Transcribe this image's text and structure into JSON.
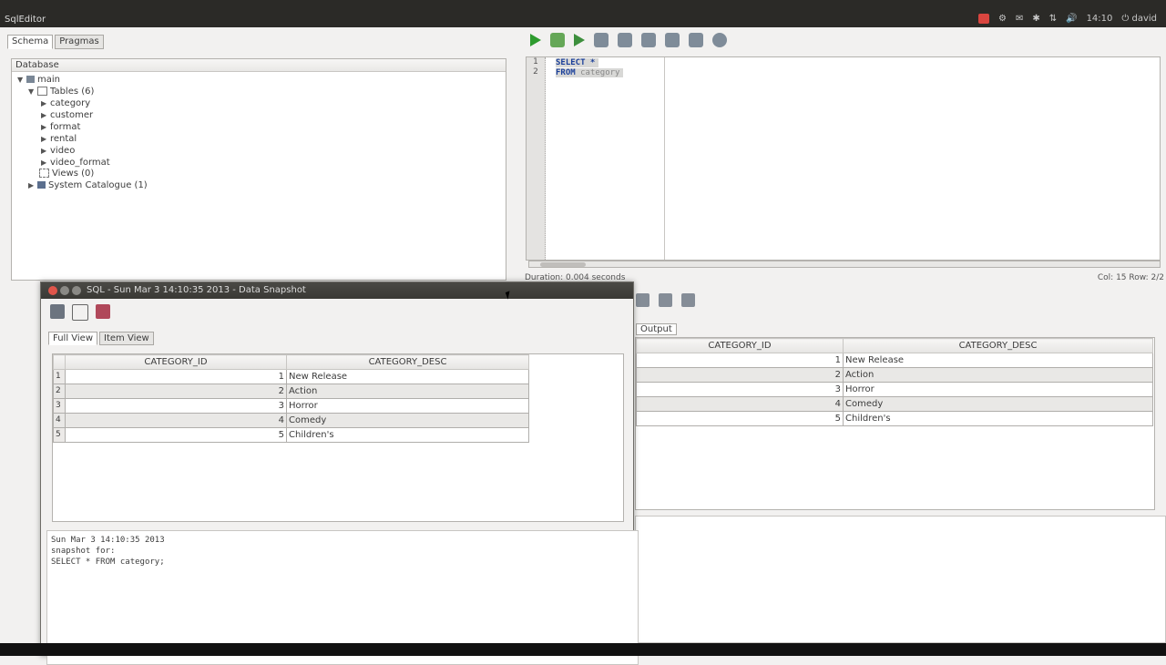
{
  "app": {
    "title": "SqlEditor"
  },
  "tray": {
    "items": [
      "⚙",
      "✉",
      "✱",
      "⇅",
      "🔊",
      "14:10",
      "⏻ david"
    ]
  },
  "schema": {
    "tabs": [
      "Schema",
      "Pragmas"
    ],
    "header": "Database",
    "tree": {
      "main": "main",
      "tables_label": "Tables (6)",
      "tables": [
        "category",
        "customer",
        "format",
        "rental",
        "video",
        "video_format"
      ],
      "views_label": "Views (0)",
      "system_label": "System Catalogue (1)"
    }
  },
  "editor": {
    "line_numbers": [
      "1",
      "2"
    ],
    "line1": "SELECT *",
    "line2_kw": "FROM",
    "line2_table": "category"
  },
  "status": {
    "duration": "Duration: 0.004 seconds",
    "cursor": "Col: 15 Row: 2/2"
  },
  "results": {
    "tab": "Output",
    "columns": [
      "CATEGORY_ID",
      "CATEGORY_DESC"
    ],
    "rows": [
      {
        "id": "1",
        "desc": "New Release"
      },
      {
        "id": "2",
        "desc": "Action"
      },
      {
        "id": "3",
        "desc": "Horror"
      },
      {
        "id": "4",
        "desc": "Comedy"
      },
      {
        "id": "5",
        "desc": "Children's"
      }
    ]
  },
  "snapshot": {
    "title": "SQL - Sun Mar 3 14:10:35 2013 - Data Snapshot",
    "tabs": [
      "Full View",
      "Item View"
    ],
    "columns": [
      "CATEGORY_ID",
      "CATEGORY_DESC"
    ],
    "rows": [
      {
        "rn": "1",
        "id": "1",
        "desc": "New Release"
      },
      {
        "rn": "2",
        "id": "2",
        "desc": "Action"
      },
      {
        "rn": "3",
        "id": "3",
        "desc": "Horror"
      },
      {
        "rn": "4",
        "id": "4",
        "desc": "Comedy"
      },
      {
        "rn": "5",
        "id": "5",
        "desc": "Children's"
      }
    ],
    "info": [
      "Sun Mar 3 14:10:35 2013",
      "snapshot for:",
      "SELECT * FROM category;"
    ]
  },
  "colors": {
    "play": "#2e9b2e",
    "close_btn": "#e0554a",
    "tray_alert": "#d9453f"
  }
}
